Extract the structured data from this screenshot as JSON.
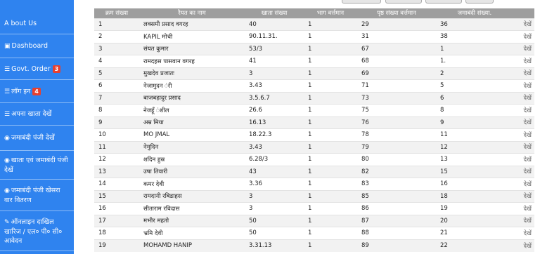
{
  "sidebar": {
    "items": [
      {
        "label": "A bout Us",
        "icon": "",
        "badge": ""
      },
      {
        "label": "Dashboard",
        "icon": "dashboard-icon",
        "badge": ""
      },
      {
        "label": "Govt. Order",
        "icon": "list-icon",
        "badge": "3"
      },
      {
        "label": "लॉग इन",
        "icon": "list-icon",
        "badge": "4"
      },
      {
        "label": "अपना खाता देखें",
        "icon": "list-icon",
        "badge": ""
      },
      {
        "label": "जमाबंदी पंजी देखें",
        "icon": "eye-icon",
        "badge": ""
      },
      {
        "label": "खाता एवं जमाबंदी पंजी देखें",
        "icon": "eye-icon",
        "badge": ""
      },
      {
        "label": "जमाबंदी पंजी खेसरा वार वितरण",
        "icon": "eye-icon",
        "badge": ""
      },
      {
        "label": "ऑनलाइन दाखिल खारिज / एल० पी० सी० आवेदन",
        "icon": "edit-icon",
        "badge": ""
      }
    ]
  },
  "table": {
    "headers": [
      "क्रम संख्या",
      "रैयत का नाम",
      "खाता संख्या",
      "भाग वर्त्तमान",
      "पृष्ठ संख्या वर्त्तमान",
      "जमाबंदी संख्या.",
      ""
    ],
    "rows": [
      [
        "1",
        "लक्समी प्रसाद वगरह",
        "40",
        "1",
        "29",
        "36",
        "देखें"
      ],
      [
        "2",
        "KAPIL मोची",
        "90.11.31.",
        "1",
        "31",
        "38",
        "देखें"
      ],
      [
        "3",
        "संयत कुमार",
        "53/3",
        "1",
        "67",
        "1",
        "देखें"
      ],
      [
        "4",
        "रामदहस पासवान वगरह",
        "41",
        "1",
        "68",
        "1.",
        "देखें"
      ],
      [
        "5",
        "मुखदेव प्रजातः",
        "3",
        "1",
        "69",
        "2",
        "देखें"
      ],
      [
        "6",
        "नेजामुदन ंरी",
        "3.43",
        "1",
        "71",
        "5",
        "देखें"
      ],
      [
        "7",
        "बाजबहादुर प्रसाद",
        "3.5.6.7",
        "1",
        "73",
        "6",
        "देखें"
      ],
      [
        "8",
        "नेजहूँ ंशील",
        "26.6",
        "1",
        "75",
        "8",
        "देखें"
      ],
      [
        "9",
        "अम्र मिया",
        "16.13",
        "1",
        "76",
        "9",
        "देखें"
      ],
      [
        "10",
        "MO JMAL",
        "18.22.3",
        "1",
        "78",
        "11",
        "देखें"
      ],
      [
        "11",
        "नेमुदिन",
        "3.43",
        "1",
        "79",
        "12",
        "देखें"
      ],
      [
        "12",
        "शदिन हुस्र",
        "6.28/3",
        "1",
        "80",
        "13",
        "देखें"
      ],
      [
        "13",
        "उषा तिवारी",
        "43",
        "1",
        "82",
        "15",
        "देखें"
      ],
      [
        "14",
        "कमर देवी",
        "3.36",
        "1",
        "83",
        "16",
        "देखें"
      ],
      [
        "15",
        "रामदानी रबिडाहस",
        "3",
        "1",
        "85",
        "18",
        "देखें"
      ],
      [
        "16",
        "सीताराम रविदास",
        "3",
        "1",
        "86",
        "19",
        "देखें"
      ],
      [
        "17",
        "मभीर महतो",
        "50",
        "1",
        "87",
        "20",
        "देखें"
      ],
      [
        "18",
        "भ्रमि देवी",
        "50",
        "1",
        "88",
        "21",
        "देखें"
      ],
      [
        "19",
        "MOHAMD HANIP",
        "3.31.13",
        "1",
        "89",
        "22",
        "देखें"
      ]
    ]
  }
}
